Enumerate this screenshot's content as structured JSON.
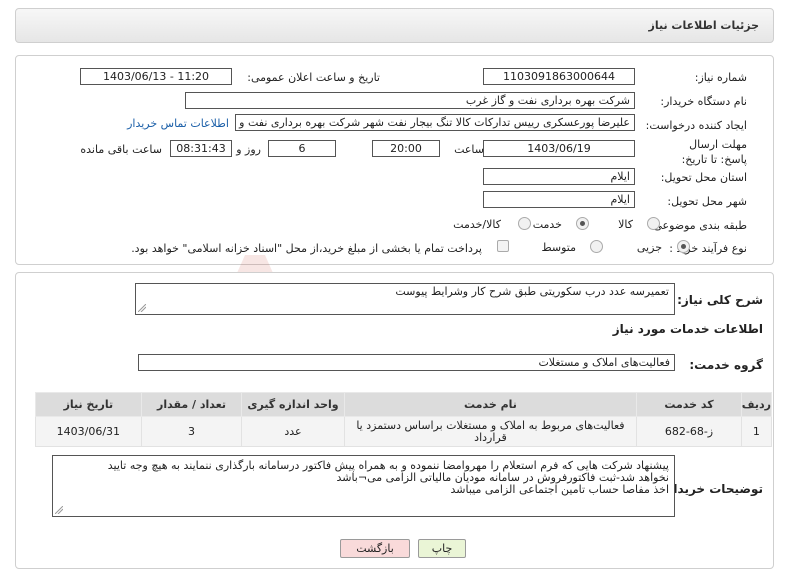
{
  "header": {
    "title": "جزئیات اطلاعات نیاز"
  },
  "fields": {
    "need_number_label": "شماره نیاز:",
    "need_number": "1103091863000644",
    "announce_label": "تاریخ و ساعت اعلان عمومی:",
    "announce_value": "1403/06/13 - 11:20",
    "buyer_org_label": "نام دستگاه خریدار:",
    "buyer_org": "شرکت بهره برداری نفت و گاز غرب",
    "creator_label": "ایجاد کننده درخواست:",
    "creator": "علیرضا پورعسکری رییس تدارکات کالا تنگ بیجار نفت شهر شرکت بهره برداری نفت و گاز غرب",
    "contact_link": "اطلاعات تماس خریدار",
    "deadline_label": "مهلت ارسال پاسخ: تا تاریخ:",
    "deadline_date": "1403/06/19",
    "time_label": "ساعت",
    "deadline_time": "20:00",
    "days_value": "6",
    "days_label": "روز و",
    "remaining_time": "08:31:43",
    "remaining_label": "ساعت باقی مانده",
    "province_label": "استان محل تحویل:",
    "province": "ایلام",
    "city_label": "شهر محل تحویل:",
    "city": "ایلام",
    "category_label": "طبقه بندی موضوعی:",
    "category_options": [
      "کالا",
      "خدمت",
      "کالا/خدمت"
    ],
    "category_selected": "خدمت",
    "process_label": "نوع فرآیند خرید :",
    "process_options": [
      "جزیی",
      "متوسط"
    ],
    "process_selected": "جزیی",
    "payment_note": "پرداخت تمام یا بخشی از مبلغ خرید،از محل \"اسناد خزانه اسلامی\" خواهد بود."
  },
  "summary": {
    "label": "شرح کلی نیاز:",
    "text": "تعمیرسه عدد درب سکوریتی طبق شرح کار وشرایط پیوست"
  },
  "services": {
    "section_title": "اطلاعات خدمات مورد نیاز",
    "group_label": "گروه خدمت:",
    "group_value": "فعالیت‌های  املاک و مستغلات",
    "table_headers": [
      "ردیف",
      "کد خدمت",
      "نام خدمت",
      "واحد اندازه گیری",
      "تعداد / مقدار",
      "تاریخ نیاز"
    ],
    "rows": [
      [
        "1",
        "ز-68-682",
        "فعالیت‌های مربوط به املاک و مستغلات براساس دستمزد یا قرارداد",
        "عدد",
        "3",
        "1403/06/31"
      ]
    ]
  },
  "buyer_notes": {
    "label": "توضیحات خریدار:",
    "lines": [
      "پیشنهاد شرکت هایی که فرم استعلام را مهروامضا ننموده و به همراه پیش فاکتور درسامانه بارگذاری ننمایند به هیچ وجه تایید",
      "نخواهد شد-ثبت فاکتورفروش در سامانه مودیان مالیاتی الزامی می¬باشد",
      "اخذ مفاصا حساب تامین اجتماعی الزامی میباشد"
    ]
  },
  "buttons": {
    "print": "چاپ",
    "back": "بازگشت"
  },
  "watermark": {
    "text": "AriaTender.neT"
  },
  "colors": {
    "link": "#1b5fa8",
    "back_button_bg": "#f9dada",
    "print_button_bg": "#eaf5d6"
  }
}
